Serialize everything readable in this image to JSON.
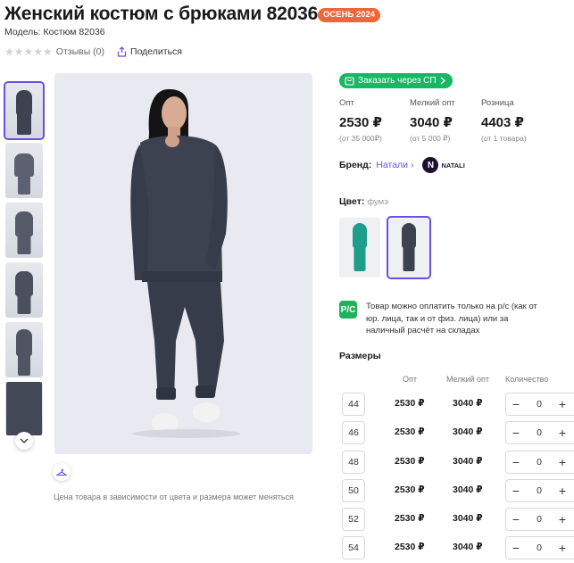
{
  "product": {
    "title": "Женский костюм с брюками 82036",
    "season_badge": "ОСЕНЬ 2024",
    "model": "Модель: Костюм 82036",
    "reviews": "Отзывы (0)",
    "share": "Поделиться"
  },
  "gallery": {
    "note": "Цена товара в зависимости от цвета и размера может меняться",
    "thumbnail_count": 6,
    "active_thumbnail": 1
  },
  "order_button": "Заказать через СП",
  "prices": [
    {
      "label": "Опт",
      "value": "2530 ₽",
      "sub": "(от 35 000₽)"
    },
    {
      "label": "Мелкий опт",
      "value": "3040 ₽",
      "sub": "(от 5 000 ₽)"
    },
    {
      "label": "Розница",
      "value": "4403 ₽",
      "sub": "(от 1 товара)"
    }
  ],
  "brand": {
    "label": "Бренд:",
    "name": "Натали",
    "logo_text": "NATALI",
    "logo_letter": "N"
  },
  "color": {
    "label": "Цвет:",
    "value": "фумэ",
    "swatches": [
      {
        "name": "teal",
        "color": "#1f9c8c"
      },
      {
        "name": "fume",
        "color": "#3c4250"
      }
    ],
    "selected": 1
  },
  "payment": {
    "icon_text": "Р/С",
    "text": "Товар можно оплатить только на р/с (как от юр. лица, так и от физ. лица) или за наличный расчёт на складах"
  },
  "sizes": {
    "title": "Размеры",
    "headers": {
      "opt": "Опт",
      "small_opt": "Мелкий опт",
      "qty": "Количество"
    },
    "rows": [
      {
        "size": "44",
        "opt": "2530 ₽",
        "small_opt": "3040 ₽",
        "qty": "0"
      },
      {
        "size": "46",
        "opt": "2530 ₽",
        "small_opt": "3040 ₽",
        "qty": "0"
      },
      {
        "size": "48",
        "opt": "2530 ₽",
        "small_opt": "3040 ₽",
        "qty": "0"
      },
      {
        "size": "50",
        "opt": "2530 ₽",
        "small_opt": "3040 ₽",
        "qty": "0"
      },
      {
        "size": "52",
        "opt": "2530 ₽",
        "small_opt": "3040 ₽",
        "qty": "0"
      },
      {
        "size": "54",
        "opt": "2530 ₽",
        "small_opt": "3040 ₽",
        "qty": "0"
      }
    ],
    "minus": "−",
    "plus": "+"
  },
  "colors": {
    "accent": "#6b4ee6",
    "season": "#f0663b",
    "green": "#18b764",
    "suit": "#3c4250"
  }
}
